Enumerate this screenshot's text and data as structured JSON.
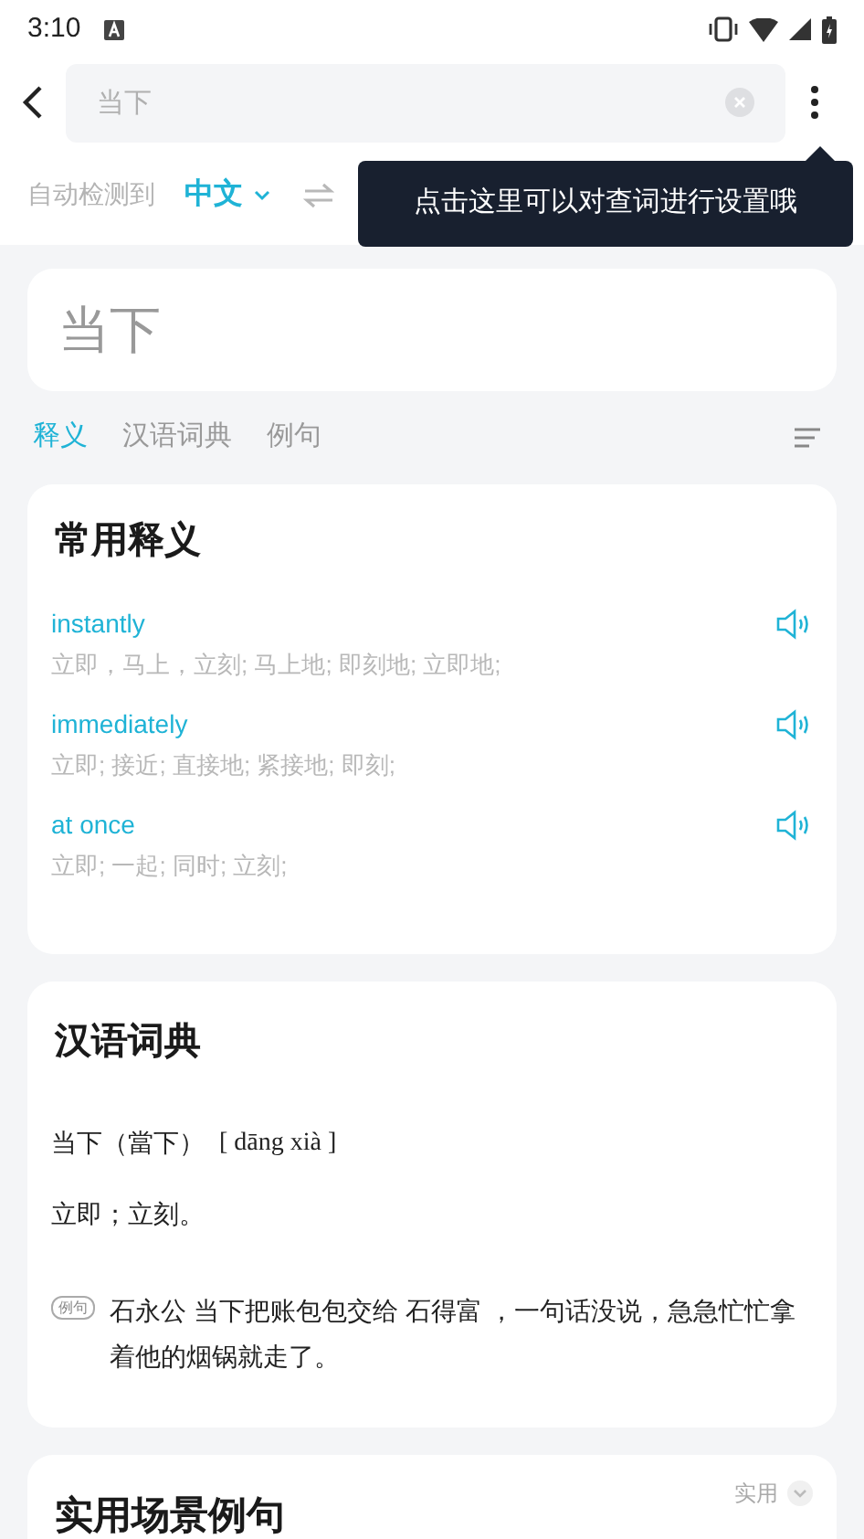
{
  "status_bar": {
    "time": "3:10"
  },
  "search": {
    "value": "当下"
  },
  "language": {
    "detected_label": "自动检测到",
    "source": "中文"
  },
  "tooltip": {
    "text": "点击这里可以对查词进行设置哦"
  },
  "headword": "当下",
  "tabs": [
    {
      "label": "释义",
      "selected": true
    },
    {
      "label": "汉语词典",
      "selected": false
    },
    {
      "label": "例句",
      "selected": false
    }
  ],
  "sections": [
    {
      "kind": "translations",
      "title": "常用释义",
      "entries": [
        {
          "word": "instantly",
          "meaning": "立即，马上，立刻; 马上地; 即刻地; 立即地;"
        },
        {
          "word": "immediately",
          "meaning": "立即; 接近; 直接地; 紧接地; 即刻;"
        },
        {
          "word": "at once",
          "meaning": "立即; 一起; 同时; 立刻;"
        }
      ]
    },
    {
      "kind": "dictionary",
      "title": "汉语词典",
      "entry": "当下（當下）",
      "pinyin": "[ dāng xià ]",
      "definition": "立即；立刻。",
      "example": {
        "badge": "例句",
        "text": "石永公 当下把账包包交给 石得富 ，一句话没说，急急忙忙拿着他的烟锅就走了。"
      }
    },
    {
      "kind": "scenes",
      "title": "实用场景例句",
      "filter": "实用"
    }
  ]
}
